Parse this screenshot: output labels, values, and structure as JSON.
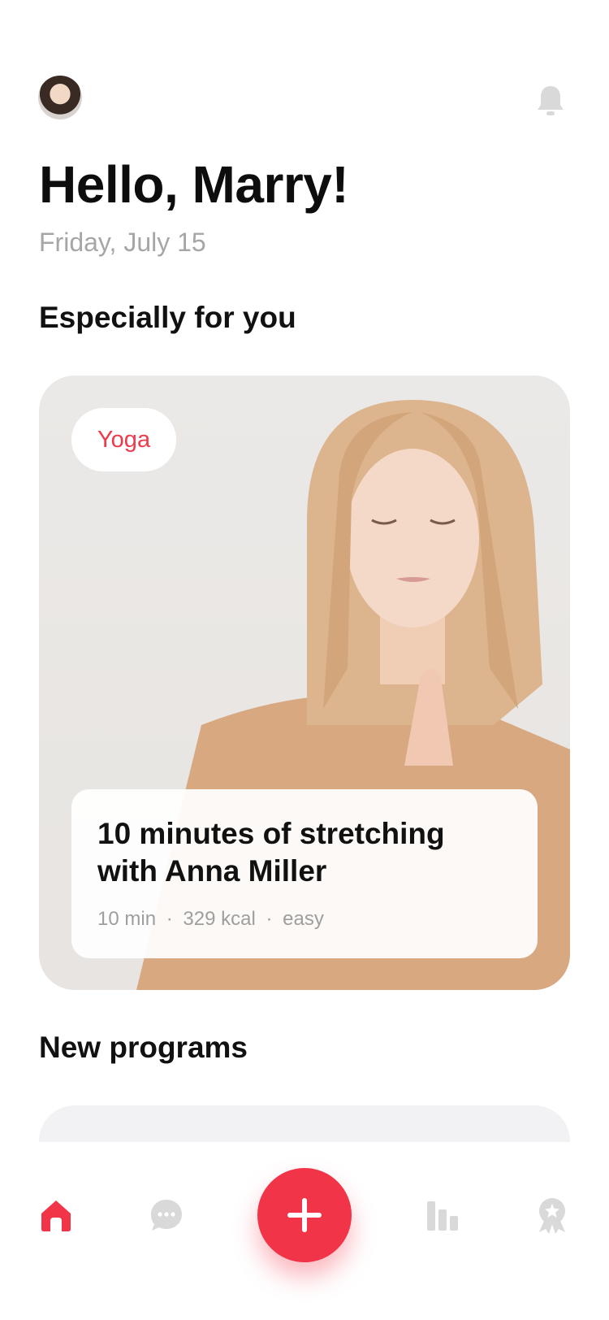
{
  "header": {
    "greeting": "Hello, Marry!",
    "date": "Friday, July 15",
    "avatar_icon": "user-avatar",
    "notification_icon": "bell-icon"
  },
  "featured": {
    "section_title": "Especially for you",
    "tag": "Yoga",
    "title_line1": "10 minutes of stretching",
    "title_line2": "with Anna Miller",
    "duration": "10 min",
    "calories": "329 kcal",
    "difficulty": "easy",
    "separator": "·"
  },
  "programs": {
    "section_title": "New programs"
  },
  "tabbar": {
    "items": [
      {
        "icon": "home-icon",
        "active": true
      },
      {
        "icon": "chat-icon",
        "active": false
      },
      {
        "icon": "plus-icon",
        "active": false
      },
      {
        "icon": "stats-icon",
        "active": false
      },
      {
        "icon": "award-icon",
        "active": false
      }
    ]
  },
  "colors": {
    "accent": "#f13447",
    "muted_text": "#a6a6a6",
    "inactive_icon": "#d9d9d9"
  }
}
